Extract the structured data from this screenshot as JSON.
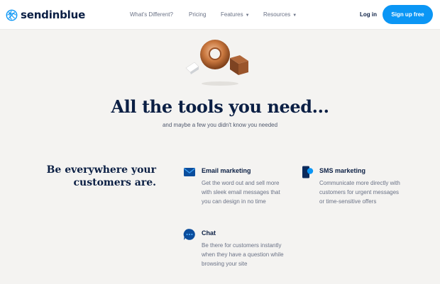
{
  "brand": {
    "name": "sendinblue",
    "accent": "#0b96f5",
    "navy": "#0b1f44"
  },
  "nav": {
    "links": [
      "What's Different?",
      "Pricing",
      "Features",
      "Resources"
    ],
    "login": "Log in",
    "signup": "Sign up free"
  },
  "hero": {
    "title": "All the tools you need...",
    "subtitle": "and maybe a few you didn't know you needed"
  },
  "section": {
    "heading_line1": "Be everywhere your",
    "heading_line2": "customers are."
  },
  "features": [
    {
      "title": "Email marketing",
      "icon": "envelope-icon",
      "desc": "Get the word out and sell more with sleek email messages that you can design in no time"
    },
    {
      "title": "SMS marketing",
      "icon": "phone-icon",
      "desc": "Communicate more directly with customers for urgent messages or time-sensitive offers"
    },
    {
      "title": "Chat",
      "icon": "chat-bubble-icon",
      "desc": "Be there for customers instantly when they have a question while browsing your site"
    }
  ]
}
